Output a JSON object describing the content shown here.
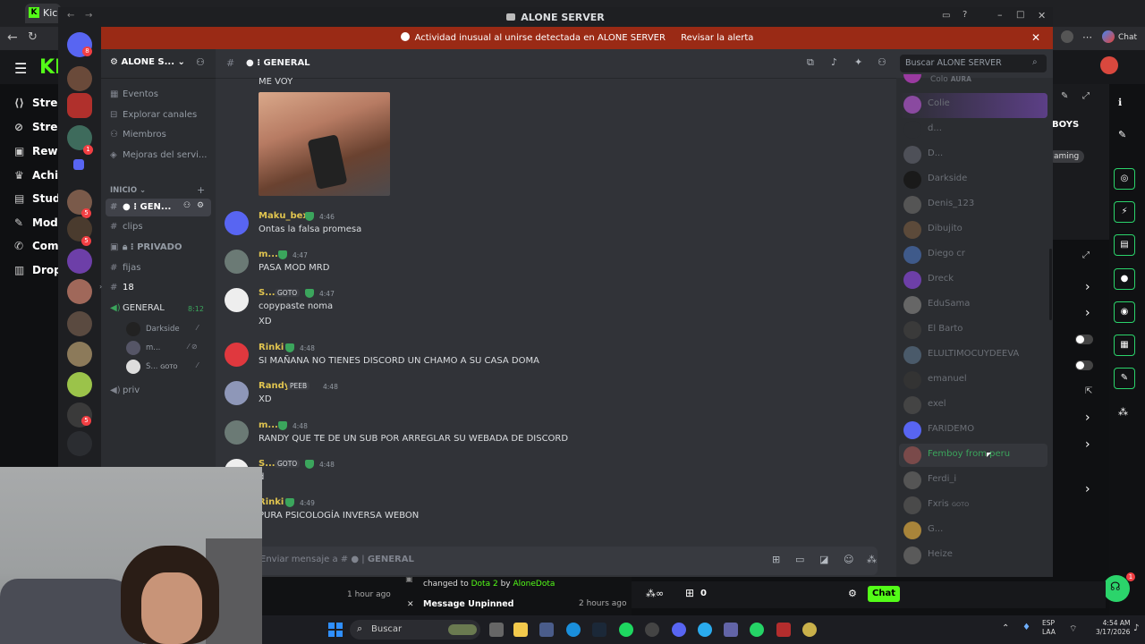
{
  "kick_browser": {
    "tab_title": "Kick",
    "sidebar_items": [
      {
        "label": "Strea",
        "icon": "stream-icon"
      },
      {
        "label": "Strea",
        "icon": "link-icon"
      },
      {
        "label": "Rewa",
        "icon": "reward-icon"
      },
      {
        "label": "Achie",
        "icon": "trophy-icon"
      },
      {
        "label": "Studi",
        "icon": "studio-icon"
      },
      {
        "label": "Mode",
        "icon": "wrench-icon"
      },
      {
        "label": "Comm",
        "icon": "megaphone-icon"
      },
      {
        "label": "Drops",
        "icon": "drops-icon"
      }
    ],
    "right_panel": {
      "boys_text": "BOYS",
      "gaming_chip": "aming",
      "chat_button": "Chat",
      "count_zero": "0",
      "chat_label": "Chat"
    },
    "activity": {
      "line1": "changed to",
      "game": "Dota 2",
      "by": "by",
      "user": "AloneDota",
      "time1": "1 hour ago",
      "line2": "Message Unpinned",
      "time2": "2 hours ago"
    }
  },
  "discord": {
    "window_title": "ALONE SERVER",
    "alert": {
      "text": "Actividad inusual al unirse detectada en ALONE SERVER",
      "action": "Revisar la alerta"
    },
    "server_name": "ALONE S...",
    "menu": [
      "Eventos",
      "Explorar canales",
      "Miembros",
      "Mejoras del servi..."
    ],
    "category": "INICIO",
    "channels": {
      "general_text": "GEN...",
      "clips": "clips",
      "privado": "PRIVADO",
      "fijas": "fijas",
      "eighteen": "18",
      "voice_general": "GENERAL",
      "voice_time": "8:12",
      "voice_users": [
        "Darkside",
        "m...",
        "S..."
      ],
      "voice_tag": "GOTO",
      "priv": "priv"
    },
    "topbar_channel": "GENERAL",
    "search_placeholder": "Buscar ALONE SERVER",
    "messages": [
      {
        "author": "",
        "time": "",
        "text": "ME VOY"
      },
      {
        "author": "Maku_bex",
        "time": "4:46",
        "text": "Ontas la falsa promesa"
      },
      {
        "author": "m...",
        "time": "4:47",
        "text": "PASA MOD MRD"
      },
      {
        "author": "S...",
        "tag": "GOTO",
        "time": "4:47",
        "text": "copypaste noma",
        "text2": "XD"
      },
      {
        "author": "Rinki",
        "time": "4:48",
        "text": "SI MAÑANA NO TIENES DISCORD UN CHAMO A SU CASA DOMA"
      },
      {
        "author": "Randy",
        "tag": "PEEB",
        "time": "4:48",
        "text": "XD"
      },
      {
        "author": "m...",
        "time": "4:48",
        "text": "RANDY QUE TE DE UN SUB POR ARREGLAR SU WEBADA DE DISCORD"
      },
      {
        "author": "S...",
        "tag": "GOTO",
        "time": "4:48",
        "text": "d"
      },
      {
        "author": "Rinki",
        "time": "4:49",
        "text": "PURA PSICOLOGÍA INVERSA WEBON"
      }
    ],
    "input_placeholder": "Enviar mensaje a #",
    "input_channel": "GENERAL",
    "members_top": [
      "Colo",
      "AURA"
    ],
    "members": [
      "Colie",
      "d...",
      "D...",
      "Darkside",
      "Denis_123",
      "Dibujito",
      "Diego cr",
      "Dreck",
      "EduSama",
      "El Barto",
      "ELULTIMOCUYDEEVA",
      "emanuel",
      "exel",
      "FARIDEMO",
      "Femboy from peru",
      "Ferdi_i",
      "Fxris",
      "G...",
      "Heize"
    ],
    "member_tag": "GOTO"
  },
  "taskbar": {
    "search": "Buscar",
    "lang1": "ESP",
    "lang2": "LAA",
    "time": "4:54 AM",
    "date": "3/17/2026"
  },
  "colors": {
    "discord_bg": "#313338",
    "alert_bg": "#9a2a15",
    "kick_green": "#53fc18",
    "author_gold": "#e0c44f"
  }
}
